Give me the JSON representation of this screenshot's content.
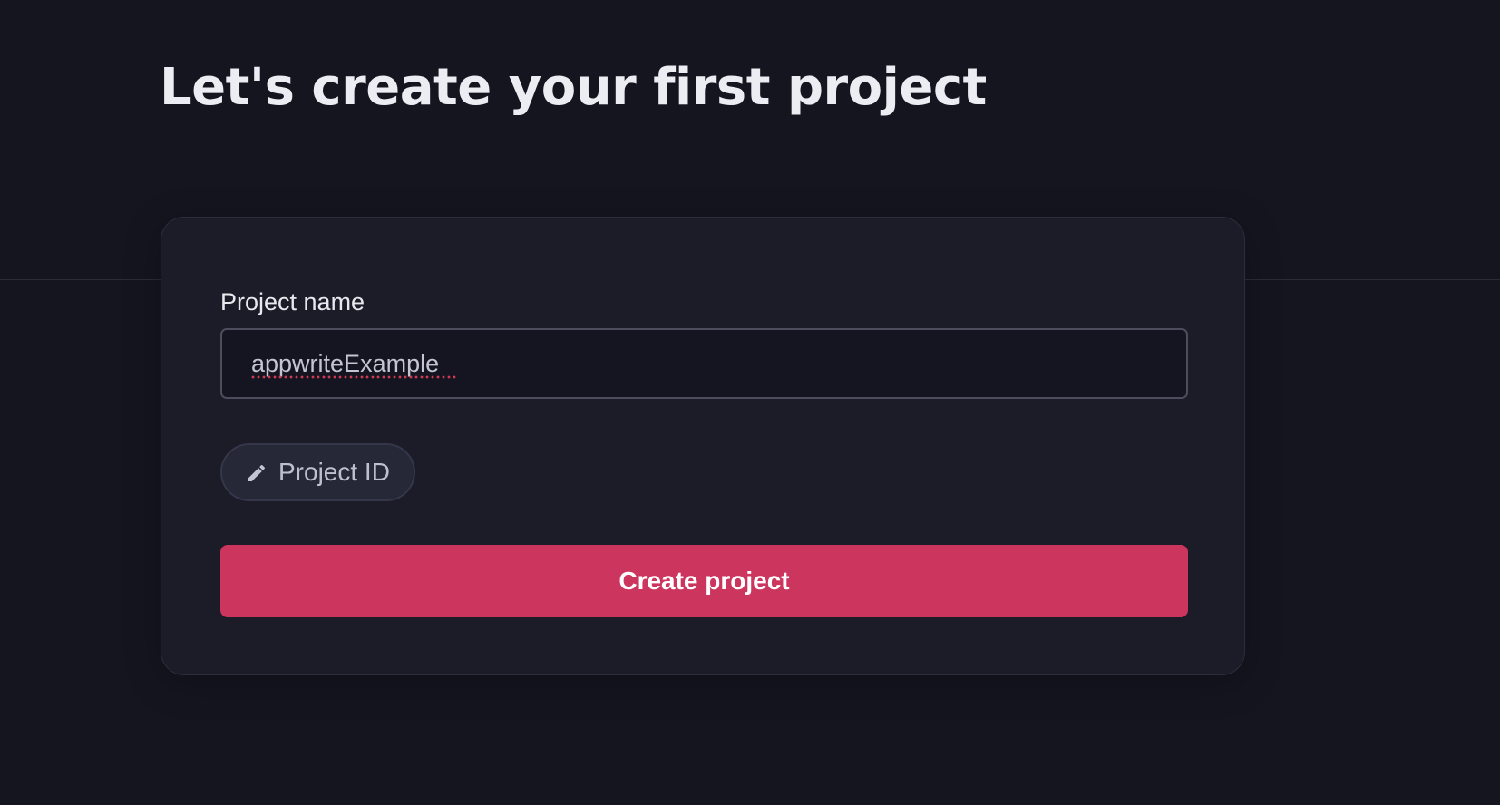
{
  "page": {
    "title": "Let's create your first project"
  },
  "form": {
    "project_name_label": "Project name",
    "project_name_value": "appwriteExample",
    "project_id_label": "Project ID",
    "project_id_icon": "pencil-icon",
    "submit_label": "Create project"
  },
  "colors": {
    "background": "#14151f",
    "card": "#1b1c27",
    "accent": "#cb355e"
  }
}
